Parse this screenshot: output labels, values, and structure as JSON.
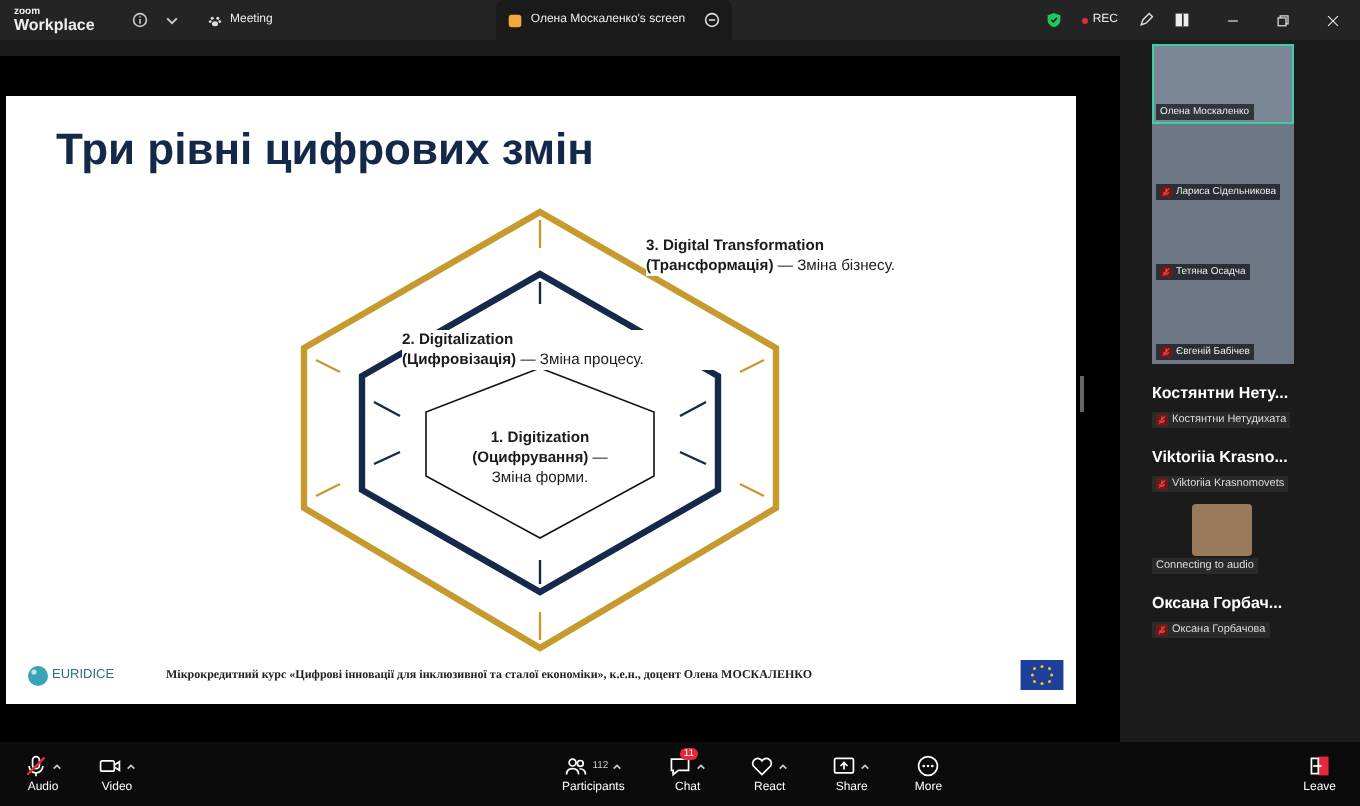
{
  "top_bar": {
    "app_name": "zoom",
    "app_subtitle": "Workplace",
    "tabs": [
      {
        "label": "Meeting",
        "selected": false
      },
      {
        "label": "Олена Москаленко's screen",
        "selected": true
      }
    ],
    "recording": "REC"
  },
  "slide": {
    "title": "Три рівні цифрових змін",
    "levels": [
      {
        "heading": "3. Digital Transformation",
        "text": "**(Трансформація)** — Зміна бізнесу."
      },
      {
        "heading": "2. Digitalization",
        "text": "**(Цифровізація)** — Зміна процесу."
      },
      {
        "heading": "1. Digitization",
        "text": "**(Оцифрування)** — Зміна форми."
      }
    ],
    "logo_text": "EURIDICE",
    "footer_text": "Мікрокредитний курс «Цифрові інновації для інклюзивної та сталої економіки», к.е.н., доцент Олена МОСКАЛЕНКО"
  },
  "video_tiles": [
    {
      "name": "Олена Москаленко",
      "muted": false,
      "selected": true
    },
    {
      "name": "Лариса Сідельникова",
      "muted": true,
      "selected": false
    },
    {
      "name": "Тетяна Осадча",
      "muted": true,
      "selected": false
    },
    {
      "name": "Євгеній Бабічев",
      "muted": true,
      "selected": false
    }
  ],
  "participants": [
    {
      "kind": "name",
      "display_name": "Костянтни Нету...",
      "label": "Костянтни Нетудихата",
      "muted": true
    },
    {
      "kind": "name",
      "display_name": "Viktoriia Krasno...",
      "label": "Viktoriia Krasnomovets",
      "muted": true
    },
    {
      "kind": "avatar",
      "label": "Connecting to audio",
      "muted": false
    },
    {
      "kind": "name",
      "display_name": "Оксана Горбач...",
      "label": "Оксана Горбачова",
      "muted": true
    }
  ],
  "toolbar": {
    "left": [
      {
        "kind": "audio",
        "label": "Audio",
        "muted": true
      },
      {
        "kind": "video",
        "label": "Video",
        "muted": false
      }
    ],
    "center": [
      {
        "kind": "participants",
        "label": "Participants",
        "count": "112"
      },
      {
        "kind": "chat",
        "label": "Chat",
        "badge": "11"
      },
      {
        "kind": "react",
        "label": "React"
      },
      {
        "kind": "share",
        "label": "Share"
      },
      {
        "kind": "more",
        "label": "More"
      }
    ],
    "leave": "Leave"
  }
}
